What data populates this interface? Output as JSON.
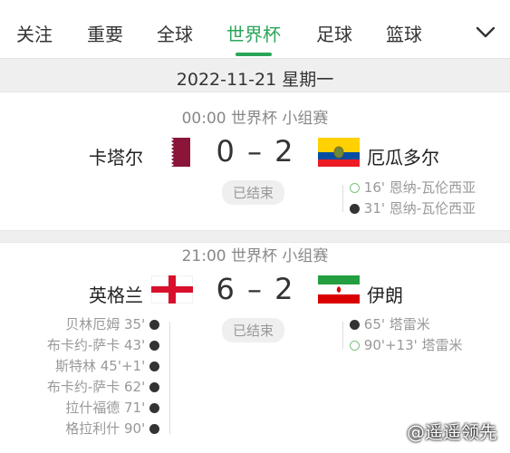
{
  "tabs": [
    {
      "label": "关注",
      "active": false
    },
    {
      "label": "重要",
      "active": false
    },
    {
      "label": "全球",
      "active": false
    },
    {
      "label": "世界杯",
      "active": true
    },
    {
      "label": "足球",
      "active": false
    },
    {
      "label": "篮球",
      "active": false
    }
  ],
  "tabs_more_icon": "chevron-down-icon",
  "accent_color": "#2aa65a",
  "date": "2022-11-21 星期一",
  "matches": [
    {
      "time": "00:00 世界杯 小组赛",
      "home": "卡塔尔",
      "away": "厄瓜多尔",
      "score": "0 – 2",
      "status": "已结束",
      "away_goals": [
        {
          "text": "16' 恩纳-瓦伦西亚",
          "type": "penalty"
        },
        {
          "text": "31' 恩纳-瓦伦西亚",
          "type": "normal"
        }
      ]
    },
    {
      "time": "21:00 世界杯 小组赛",
      "home": "英格兰",
      "away": "伊朗",
      "score": "6 – 2",
      "status": "已结束",
      "home_goals": [
        {
          "text": "贝林厄姆 35'",
          "type": "normal"
        },
        {
          "text": "布卡约-萨卡 43'",
          "type": "normal"
        },
        {
          "text": "斯特林 45'+1'",
          "type": "normal"
        },
        {
          "text": "布卡约-萨卡 62'",
          "type": "normal"
        },
        {
          "text": "拉什福德 71'",
          "type": "normal"
        },
        {
          "text": "格拉利什 90'",
          "type": "normal"
        }
      ],
      "away_goals": [
        {
          "text": "65' 塔雷米",
          "type": "normal"
        },
        {
          "text": "90'+13' 塔雷米",
          "type": "penalty"
        }
      ]
    }
  ],
  "watermark": "@遥遥领先"
}
